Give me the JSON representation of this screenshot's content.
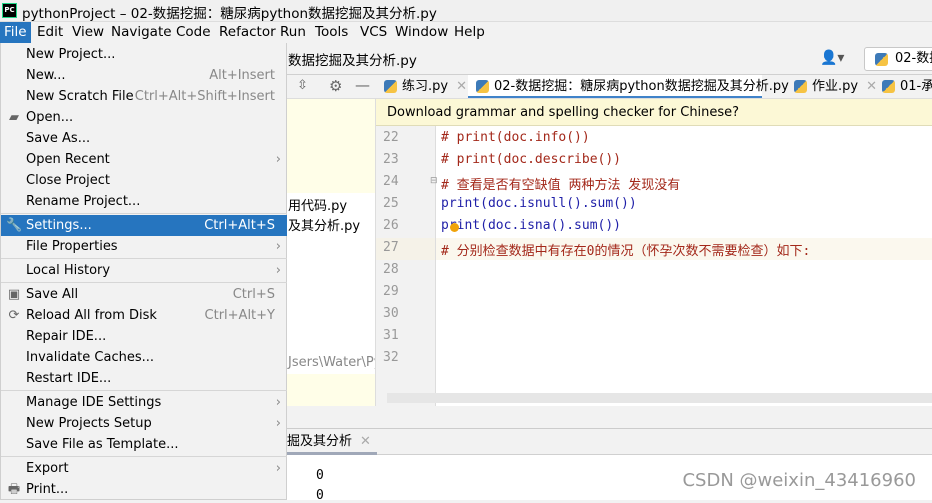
{
  "window": {
    "app_icon": "PC",
    "title": "pythonProject – 02-数据挖掘：糖尿病python数据挖掘及其分析.py"
  },
  "menubar": [
    "File",
    "Edit",
    "View",
    "Navigate",
    "Code",
    "Refactor",
    "Run",
    "Tools",
    "VCS",
    "Window",
    "Help"
  ],
  "navbar": {
    "breadcrumb": "数据挖掘及其分析.py",
    "run_config": "02-数据"
  },
  "tabs": [
    {
      "label": "练习.py",
      "active": false
    },
    {
      "label": "02-数据挖掘：糖尿病python数据挖掘及其分析.py",
      "active": true
    },
    {
      "label": "作业.py",
      "active": false
    },
    {
      "label": "01-承",
      "active": false
    }
  ],
  "project": {
    "items": [
      "用代码.py",
      "及其分析.py"
    ],
    "path": "Jsers\\Water\\Pyc"
  },
  "banner": "Download grammar and spelling checker for Chinese?",
  "editor": {
    "lines": [
      {
        "n": "22",
        "text": "# print(doc.info())",
        "type": "comment"
      },
      {
        "n": "23",
        "text": "# print(doc.describe())",
        "type": "comment"
      },
      {
        "n": "24",
        "text": "# 查看是否有空缺值 两种方法 发现没有",
        "type": "comment"
      },
      {
        "n": "25",
        "text": "print(doc.isnull().sum())",
        "type": "code"
      },
      {
        "n": "26",
        "text": "print(doc.isna().sum())",
        "type": "code"
      },
      {
        "n": "27",
        "text": "# 分别检查数据中有存在0的情况（怀孕次数不需要检查）如下:",
        "type": "comment"
      },
      {
        "n": "28",
        "text": "",
        "type": "code"
      },
      {
        "n": "29",
        "text": "",
        "type": "code"
      },
      {
        "n": "30",
        "text": "",
        "type": "code"
      },
      {
        "n": "31",
        "text": "",
        "type": "code"
      },
      {
        "n": "32",
        "text": "",
        "type": "code"
      }
    ]
  },
  "run_panel": {
    "tab": "掘及其分析",
    "output": [
      "0",
      "0"
    ]
  },
  "watermark": "CSDN @weixin_43416960",
  "file_menu": [
    {
      "label": "New Project...",
      "shortcut": ""
    },
    {
      "label": "New...",
      "shortcut": "Alt+Insert"
    },
    {
      "label": "New Scratch File",
      "shortcut": "Ctrl+Alt+Shift+Insert"
    },
    {
      "label": "Open...",
      "shortcut": "",
      "icon": "folder-icon"
    },
    {
      "label": "Save As...",
      "shortcut": ""
    },
    {
      "label": "Open Recent",
      "shortcut": "",
      "submenu": true
    },
    {
      "label": "Close Project",
      "shortcut": ""
    },
    {
      "label": "Rename Project...",
      "shortcut": ""
    },
    {
      "label": "Settings...",
      "shortcut": "Ctrl+Alt+S",
      "icon": "wrench-icon",
      "selected": true
    },
    {
      "label": "File Properties",
      "shortcut": "",
      "submenu": true
    },
    {
      "label": "Local History",
      "shortcut": "",
      "submenu": true
    },
    {
      "label": "Save All",
      "shortcut": "Ctrl+S",
      "icon": "save-icon"
    },
    {
      "label": "Reload All from Disk",
      "shortcut": "Ctrl+Alt+Y",
      "icon": "reload-icon"
    },
    {
      "label": "Repair IDE...",
      "shortcut": ""
    },
    {
      "label": "Invalidate Caches...",
      "shortcut": ""
    },
    {
      "label": "Restart IDE...",
      "shortcut": ""
    },
    {
      "label": "Manage IDE Settings",
      "shortcut": "",
      "submenu": true
    },
    {
      "label": "New Projects Setup",
      "shortcut": "",
      "submenu": true
    },
    {
      "label": "Save File as Template...",
      "shortcut": ""
    },
    {
      "label": "Export",
      "shortcut": "",
      "submenu": true
    },
    {
      "label": "Print...",
      "shortcut": "",
      "icon": "print-icon"
    }
  ]
}
